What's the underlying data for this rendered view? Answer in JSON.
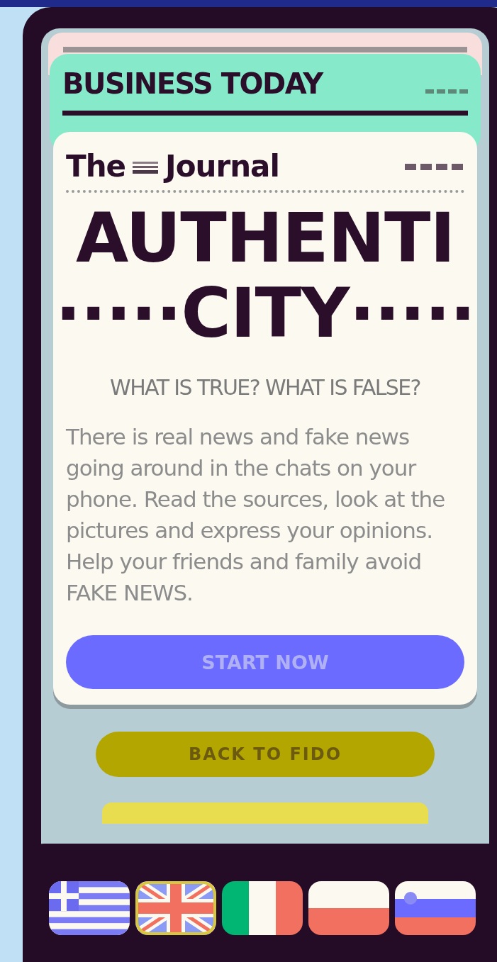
{
  "back_card": {
    "title": "BUSINESS TODAY"
  },
  "front_card": {
    "masthead_left": "The",
    "masthead_right": "Journal",
    "headline": [
      "AUTHENTI",
      "·····CITY·····"
    ],
    "subtitle": "WHAT IS TRUE? WHAT IS FALSE?",
    "body": "There is real news and fake news going around in the chats on your phone. Read the sources, look at the pictures and express your opinions. Help your friends and family avoid FAKE NEWS.",
    "button": "START NOW"
  },
  "back_button": "BACK TO FIDO",
  "languages": [
    {
      "kind": "greece",
      "selected": false
    },
    {
      "kind": "uk",
      "selected": true
    },
    {
      "kind": "italy",
      "selected": false
    },
    {
      "kind": "poland",
      "selected": false
    },
    {
      "kind": "slovenia",
      "selected": false
    }
  ]
}
